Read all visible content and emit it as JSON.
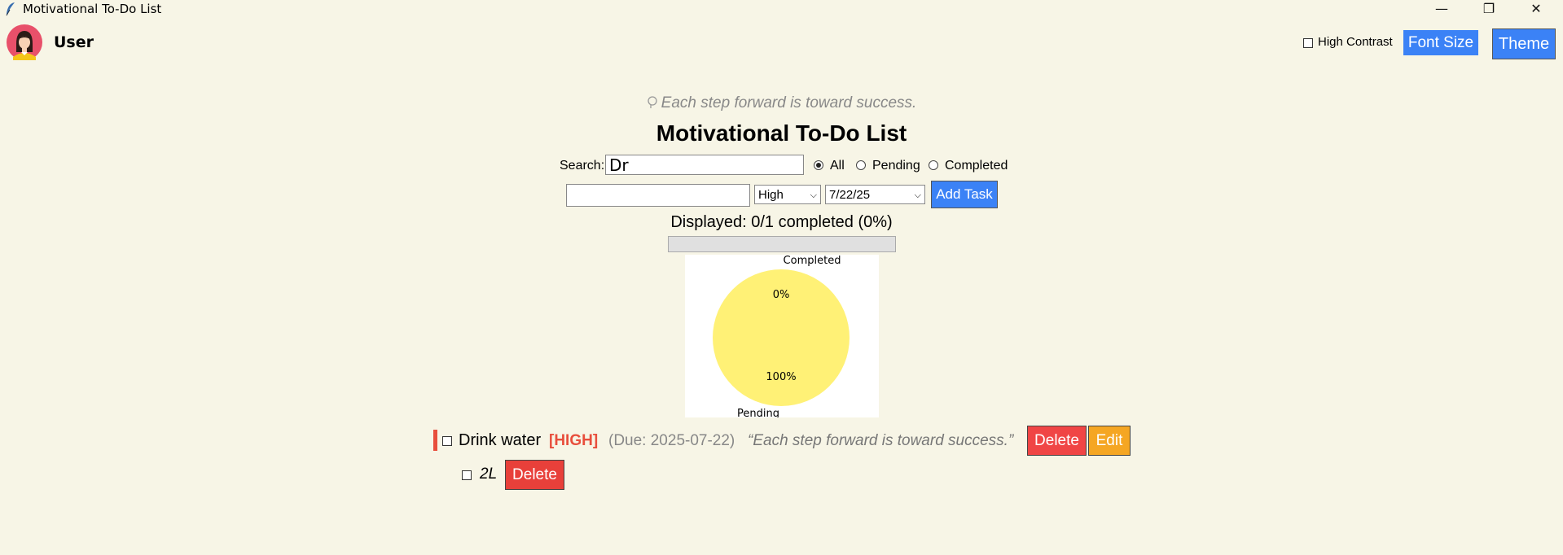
{
  "window": {
    "title": "Motivational To-Do List",
    "minimize_glyph": "—",
    "restore_glyph": "❐",
    "close_glyph": "✕"
  },
  "header": {
    "user_name": "User",
    "high_contrast_label": "High Contrast",
    "high_contrast_checked": false,
    "font_size_label": "Font Size",
    "theme_label": "Theme"
  },
  "quote_banner": "Each step forward is toward success.",
  "page_title": "Motivational To-Do List",
  "search": {
    "label": "Search:",
    "value": "Dr",
    "filters": [
      {
        "label": "All",
        "selected": true
      },
      {
        "label": "Pending",
        "selected": false
      },
      {
        "label": "Completed",
        "selected": false
      }
    ]
  },
  "add_task": {
    "input_value": "",
    "priority_selected": "High",
    "date_selected": "7/22/25",
    "button_label": "Add Task"
  },
  "progress": {
    "text": "Displayed: 0/1 completed (0%)",
    "fraction": 0
  },
  "chart_data": {
    "type": "pie",
    "slices": [
      {
        "label": "Completed",
        "value": 0,
        "pct_label": "0%",
        "color": "#90ee90"
      },
      {
        "label": "Pending",
        "value": 100,
        "pct_label": "100%",
        "color": "#fff176"
      }
    ]
  },
  "tasks": [
    {
      "name": "Drink water",
      "priority": "[HIGH]",
      "priority_color": "#e84e3c",
      "due": "(Due: 2025-07-22)",
      "quote": "“Each step forward is toward success.”",
      "delete_label": "Delete",
      "edit_label": "Edit",
      "subtasks": [
        {
          "name": "2L",
          "delete_label": "Delete"
        }
      ]
    }
  ]
}
